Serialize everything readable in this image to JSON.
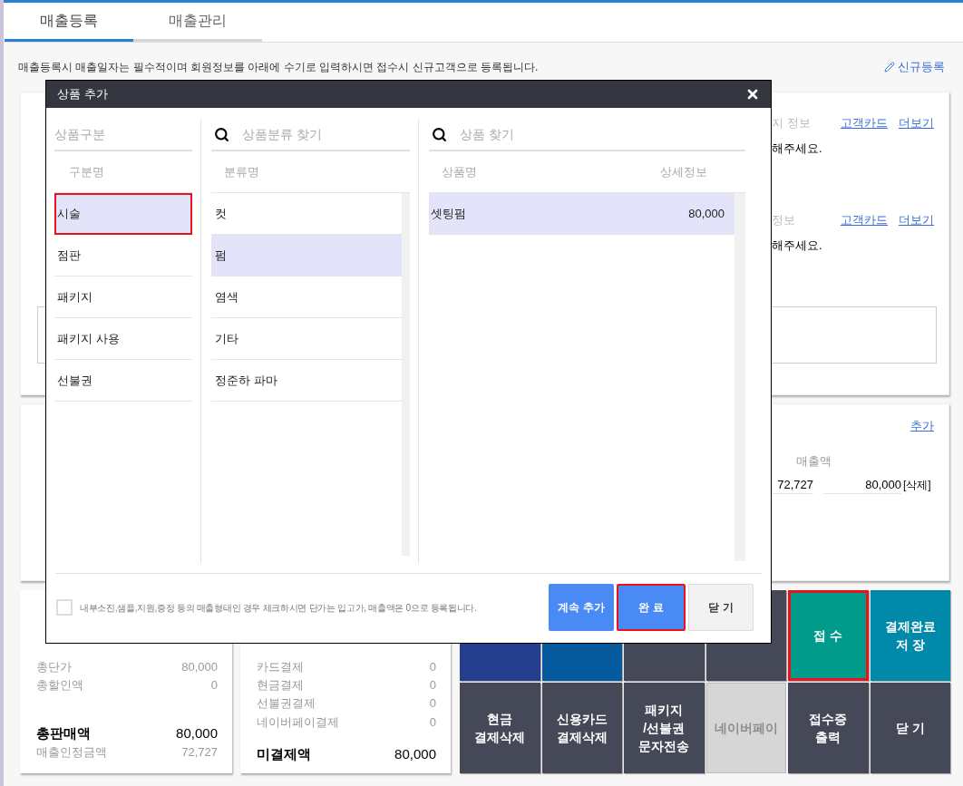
{
  "tabs": [
    {
      "label": "매출등록",
      "selected": true
    },
    {
      "label": "매출관리",
      "selected": false
    }
  ],
  "notice": "매출등록시 매출일자는 필수적이며 회원정보를 아래에 수기로 입력하시면 접수시 신규고객으로 등록됩니다.",
  "new_customer_link": "신규등록",
  "customer_card": {
    "sections": [
      {
        "label_fragment": "지 정보",
        "links": [
          "고객카드",
          "더보기"
        ],
        "message_fragment": "해주세요."
      },
      {
        "label_fragment": "정보",
        "links": [
          "고객카드",
          "더보기"
        ],
        "message_fragment": "해주세요."
      }
    ]
  },
  "items_card": {
    "add_link": "추가",
    "column_header": "매출액",
    "row": {
      "supply_value": "72,727",
      "amount": "80,000",
      "delete_link": "[삭제]"
    }
  },
  "summary": {
    "rows": [
      {
        "label": "총단가",
        "value": "80,000",
        "kind": "normal"
      },
      {
        "label": "총할인액",
        "value": "0",
        "kind": "normal"
      },
      {
        "label": "총판매액",
        "value": "80,000",
        "kind": "total"
      },
      {
        "label": "매출인정금액",
        "value": "72,727",
        "kind": "normal"
      }
    ]
  },
  "payments": {
    "rows": [
      {
        "label": "카드결제",
        "value": "0",
        "kind": "normal"
      },
      {
        "label": "현금결제",
        "value": "0",
        "kind": "normal"
      },
      {
        "label": "선불권결제",
        "value": "0",
        "kind": "normal"
      },
      {
        "label": "네이버페이결제",
        "value": "0",
        "kind": "normal"
      },
      {
        "label": "미결제액",
        "value": "80,000",
        "kind": "total"
      }
    ]
  },
  "action_buttons": [
    {
      "color": "#253f8e",
      "disabled": false,
      "highlighted": false
    },
    {
      "color": "#055a9e",
      "disabled": false,
      "highlighted": false
    },
    {
      "color": "#454857",
      "disabled": false,
      "highlighted": false
    },
    {
      "color": "#454857",
      "disabled": false,
      "highlighted": false
    },
    {
      "lines": [
        "접 수"
      ],
      "color": "#009b8a",
      "disabled": false,
      "highlighted": true
    },
    {
      "lines": [
        "결제완료",
        "저 장"
      ],
      "color": "#0089a9",
      "disabled": false,
      "highlighted": false
    },
    {
      "lines": [
        "현금",
        "결제삭제"
      ],
      "color": "#454857",
      "disabled": false,
      "highlighted": false
    },
    {
      "lines": [
        "신용카드",
        "결제삭제"
      ],
      "color": "#454857",
      "disabled": false,
      "highlighted": false
    },
    {
      "lines": [
        "패키지",
        "/선불권",
        "문자전송"
      ],
      "color": "#454857",
      "disabled": false,
      "highlighted": false
    },
    {
      "lines": [
        "네이버페이"
      ],
      "color": "#d6d6d6",
      "disabled": true,
      "highlighted": false
    },
    {
      "lines": [
        "접수증",
        "출력"
      ],
      "color": "#454857",
      "disabled": false,
      "highlighted": false
    },
    {
      "lines": [
        "닫 기"
      ],
      "color": "#454857",
      "disabled": false,
      "highlighted": false
    }
  ],
  "dialog": {
    "title": "상품 추가",
    "category_panel": {
      "heading": "상품구분",
      "column": "구분명",
      "items": [
        {
          "label": "시술",
          "selected": true,
          "highlighted": true
        },
        {
          "label": "점판",
          "selected": false,
          "highlighted": false
        },
        {
          "label": "패키지",
          "selected": false,
          "highlighted": false
        },
        {
          "label": "패키지 사용",
          "selected": false,
          "highlighted": false
        },
        {
          "label": "선불권",
          "selected": false,
          "highlighted": false
        }
      ]
    },
    "class_panel": {
      "search_placeholder": "상품분류 찾기",
      "column": "분류명",
      "items": [
        {
          "label": "컷",
          "selected": false
        },
        {
          "label": "펌",
          "selected": true
        },
        {
          "label": "염색",
          "selected": false
        },
        {
          "label": "기타",
          "selected": false
        },
        {
          "label": "정준하 파마",
          "selected": false
        }
      ]
    },
    "product_panel": {
      "search_placeholder": "상품 찾기",
      "columns": [
        "상품명",
        "상세정보"
      ],
      "rows": [
        {
          "name": "셋팅펌",
          "price": "80,000",
          "selected": true
        }
      ]
    },
    "zero_price_option": {
      "label": "내부소진,샘플,지원,증정 등의 매출형태인 경우 체크하시면 단가는 입고가, 매출액은 0으로 등록됩니다.",
      "checked": false
    },
    "buttons": [
      {
        "label": "계속 추가",
        "kind": "primary",
        "highlighted": false
      },
      {
        "label": "완 료",
        "kind": "primary",
        "highlighted": true
      },
      {
        "label": "닫 기",
        "kind": "secondary",
        "highlighted": false
      }
    ]
  }
}
